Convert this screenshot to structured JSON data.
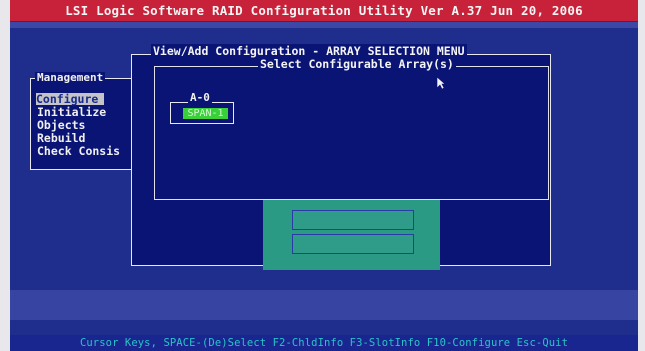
{
  "window": {
    "title": "LSI Logic Software RAID Configuration Utility Ver A.37 Jun 20, 2006"
  },
  "management_menu": {
    "title": "Management",
    "items": [
      {
        "label": "Configure",
        "selected": true
      },
      {
        "label": "Initialize",
        "selected": false
      },
      {
        "label": "Objects",
        "selected": false
      },
      {
        "label": "Rebuild",
        "selected": false
      },
      {
        "label": "Check Consis",
        "selected": false
      }
    ]
  },
  "dialog": {
    "title": "View/Add Configuration - ARRAY SELECTION MENU",
    "subtitle": "Select Configurable Array(s)"
  },
  "array": {
    "label": "A-0",
    "slot_value": "SPAN-1"
  },
  "status_bar": {
    "text": "Cursor Keys, SPACE-(De)Select F2-ChldInfo F3-SlotInfo F10-Configure Esc-Quit"
  },
  "colors": {
    "title_bar": "#c8223a",
    "screen_bg": "#1f2d8c",
    "panel_bg": "#0a1474",
    "selected_item": "#c4c4c8",
    "array_slot": "#3ad03a",
    "teal_box": "#2a9a84",
    "status_text": "#29c4c8"
  },
  "icons": {
    "pointer": "mouse-pointer-icon"
  }
}
